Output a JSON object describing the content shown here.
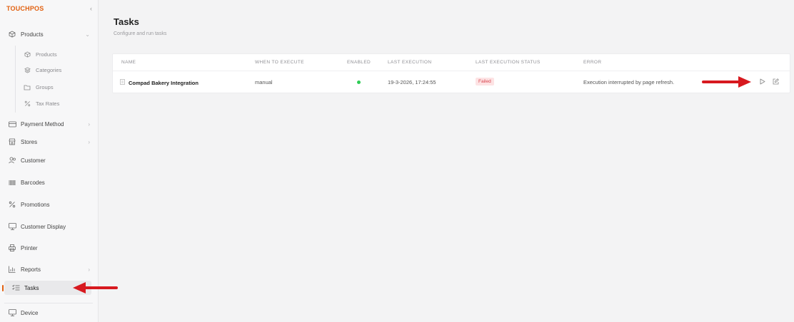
{
  "sidebar": {
    "brand": "TOUCHPOS",
    "collapse_glyph": "‹",
    "items": [
      {
        "label": "Products",
        "icon": "box-icon",
        "chevron": "⌄"
      },
      {
        "label": "Payment Method",
        "icon": "card-icon",
        "chevron": "›"
      },
      {
        "label": "Stores",
        "icon": "store-icon",
        "chevron": "›"
      },
      {
        "label": "Customer",
        "icon": "users-icon"
      },
      {
        "label": "Barcodes",
        "icon": "barcode-icon"
      },
      {
        "label": "Promotions",
        "icon": "percent-icon"
      },
      {
        "label": "Customer Display",
        "icon": "monitor-icon"
      },
      {
        "label": "Printer",
        "icon": "printer-icon"
      },
      {
        "label": "Reports",
        "icon": "chart-icon",
        "chevron": "›"
      },
      {
        "label": "Tasks",
        "icon": "tasks-icon",
        "active": true
      },
      {
        "label": "Device",
        "icon": "monitor-icon"
      }
    ],
    "products_sub": [
      {
        "label": "Products",
        "icon": "box-icon"
      },
      {
        "label": "Categories",
        "icon": "layers-icon"
      },
      {
        "label": "Groups",
        "icon": "folder-icon"
      },
      {
        "label": "Tax Rates",
        "icon": "percent-icon"
      }
    ]
  },
  "page": {
    "title": "Tasks",
    "subtitle": "Configure and run tasks"
  },
  "table": {
    "headers": [
      "NAME",
      "WHEN TO EXECUTE",
      "ENABLED",
      "LAST EXECUTION",
      "LAST EXECUTION STATUS",
      "ERROR"
    ],
    "rows": [
      {
        "name": "Compad Bakery Integration",
        "when": "manual",
        "enabled": true,
        "last_execution": "19-3-2026, 17:24:55",
        "status": "Failed",
        "error": "Execution interrupted by page refresh."
      }
    ]
  },
  "colors": {
    "accent": "#e2600f",
    "enabled_dot": "#2ecc55",
    "failed_bg": "#fde3e4",
    "failed_text": "#d9434d",
    "annotation_arrow": "#d7191f"
  }
}
